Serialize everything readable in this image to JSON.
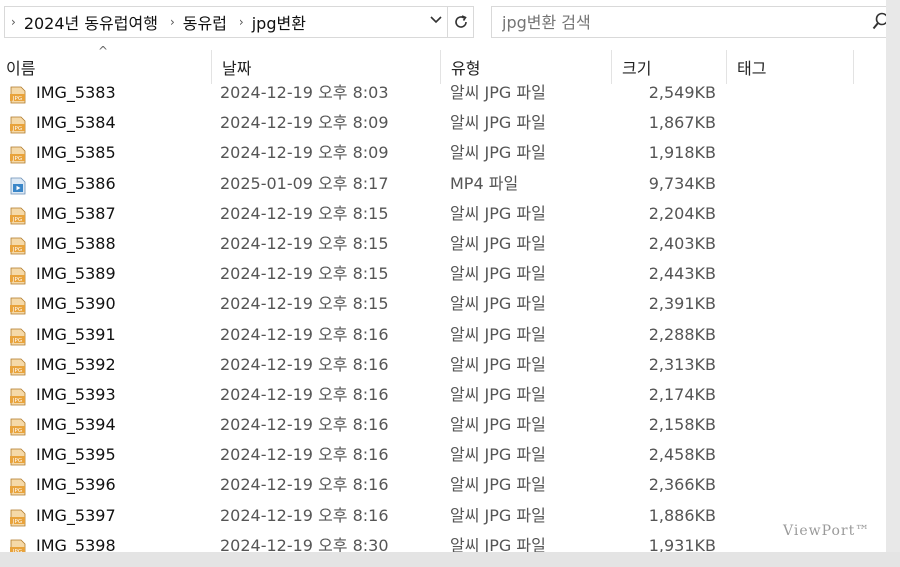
{
  "address_bar": {
    "breadcrumbs": [
      "2024년 동유럽여행",
      "동유럽",
      "jpg변환"
    ]
  },
  "search": {
    "placeholder": "jpg변환 검색"
  },
  "columns": {
    "name": "이름",
    "date": "날짜",
    "type": "유형",
    "size": "크기",
    "tags": "태그"
  },
  "files": [
    {
      "name": "IMG_5383",
      "date": "2024-12-19 오후 8:03",
      "type": "알씨 JPG 파일",
      "size": "2,549KB",
      "icon": "jpg-file-icon"
    },
    {
      "name": "IMG_5384",
      "date": "2024-12-19 오후 8:09",
      "type": "알씨 JPG 파일",
      "size": "1,867KB",
      "icon": "jpg-file-icon"
    },
    {
      "name": "IMG_5385",
      "date": "2024-12-19 오후 8:09",
      "type": "알씨 JPG 파일",
      "size": "1,918KB",
      "icon": "jpg-file-icon"
    },
    {
      "name": "IMG_5386",
      "date": "2025-01-09 오후 8:17",
      "type": "MP4 파일",
      "size": "9,734KB",
      "icon": "video-file-icon"
    },
    {
      "name": "IMG_5387",
      "date": "2024-12-19 오후 8:15",
      "type": "알씨 JPG 파일",
      "size": "2,204KB",
      "icon": "jpg-file-icon"
    },
    {
      "name": "IMG_5388",
      "date": "2024-12-19 오후 8:15",
      "type": "알씨 JPG 파일",
      "size": "2,403KB",
      "icon": "jpg-file-icon"
    },
    {
      "name": "IMG_5389",
      "date": "2024-12-19 오후 8:15",
      "type": "알씨 JPG 파일",
      "size": "2,443KB",
      "icon": "jpg-file-icon"
    },
    {
      "name": "IMG_5390",
      "date": "2024-12-19 오후 8:15",
      "type": "알씨 JPG 파일",
      "size": "2,391KB",
      "icon": "jpg-file-icon"
    },
    {
      "name": "IMG_5391",
      "date": "2024-12-19 오후 8:16",
      "type": "알씨 JPG 파일",
      "size": "2,288KB",
      "icon": "jpg-file-icon"
    },
    {
      "name": "IMG_5392",
      "date": "2024-12-19 오후 8:16",
      "type": "알씨 JPG 파일",
      "size": "2,313KB",
      "icon": "jpg-file-icon"
    },
    {
      "name": "IMG_5393",
      "date": "2024-12-19 오후 8:16",
      "type": "알씨 JPG 파일",
      "size": "2,174KB",
      "icon": "jpg-file-icon"
    },
    {
      "name": "IMG_5394",
      "date": "2024-12-19 오후 8:16",
      "type": "알씨 JPG 파일",
      "size": "2,158KB",
      "icon": "jpg-file-icon"
    },
    {
      "name": "IMG_5395",
      "date": "2024-12-19 오후 8:16",
      "type": "알씨 JPG 파일",
      "size": "2,458KB",
      "icon": "jpg-file-icon"
    },
    {
      "name": "IMG_5396",
      "date": "2024-12-19 오후 8:16",
      "type": "알씨 JPG 파일",
      "size": "2,366KB",
      "icon": "jpg-file-icon"
    },
    {
      "name": "IMG_5397",
      "date": "2024-12-19 오후 8:16",
      "type": "알씨 JPG 파일",
      "size": "1,886KB",
      "icon": "jpg-file-icon"
    },
    {
      "name": "IMG_5398",
      "date": "2024-12-19 오후 8:30",
      "type": "알씨 JPG 파일",
      "size": "1,931KB",
      "icon": "jpg-file-icon"
    }
  ],
  "watermark": "ViewPort™",
  "colors": {
    "jpg_icon": "#e8a33c",
    "video_icon": "#3a86c8"
  }
}
